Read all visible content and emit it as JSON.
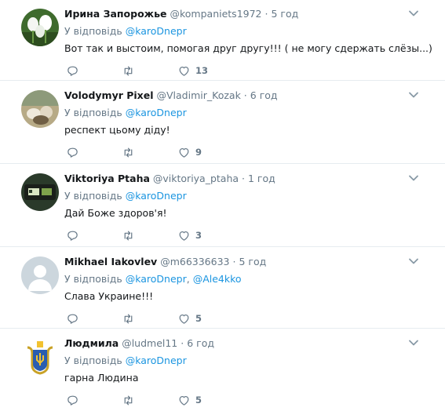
{
  "colors": {
    "link": "#1b95e0",
    "muted": "#657786",
    "text": "#14171a",
    "divider": "#e6ecf0"
  },
  "replies": [
    {
      "name": "Ирина Запорожье",
      "handle": "@kompaniets1972",
      "sep": "·",
      "time": "5 год",
      "reply_prefix": "У відповідь",
      "mentions": [
        "@karoDnepr"
      ],
      "text": "Вот так и выстоим, помогая друг другу!!! ( не могу сдержать слёзы...)",
      "likes": "13",
      "avatar": "snowdrop-flowers"
    },
    {
      "name": "Volodymyr Pixel",
      "handle": "@Vladimir_Kozak",
      "sep": "·",
      "time": "6 год",
      "reply_prefix": "У відповідь",
      "mentions": [
        "@karoDnepr"
      ],
      "text": "респект цьому діду!",
      "likes": "9",
      "avatar": "stone-landscape"
    },
    {
      "name": "Viktoriya Ptaha",
      "handle": "@viktoriya_ptaha",
      "sep": "·",
      "time": "1 год",
      "reply_prefix": "У відповідь",
      "mentions": [
        "@karoDnepr"
      ],
      "text": "Дай Боже здоров'я!",
      "likes": "3",
      "avatar": "dark-device"
    },
    {
      "name": "Mikhael Iakovlev",
      "handle": "@m66336633",
      "sep": "·",
      "time": "5 год",
      "reply_prefix": "У відповідь",
      "mentions": [
        "@karoDnepr",
        "@Ale4kko"
      ],
      "mention_sep": ",",
      "text": "Слава Украине!!!",
      "likes": "5",
      "avatar": "default-avatar"
    },
    {
      "name": "Людмила",
      "handle": "@ludmel11",
      "sep": "·",
      "time": "6 год",
      "reply_prefix": "У відповідь",
      "mentions": [
        "@karoDnepr"
      ],
      "text": "гарна Людина",
      "likes": "5",
      "avatar": "coat-of-arms"
    }
  ]
}
